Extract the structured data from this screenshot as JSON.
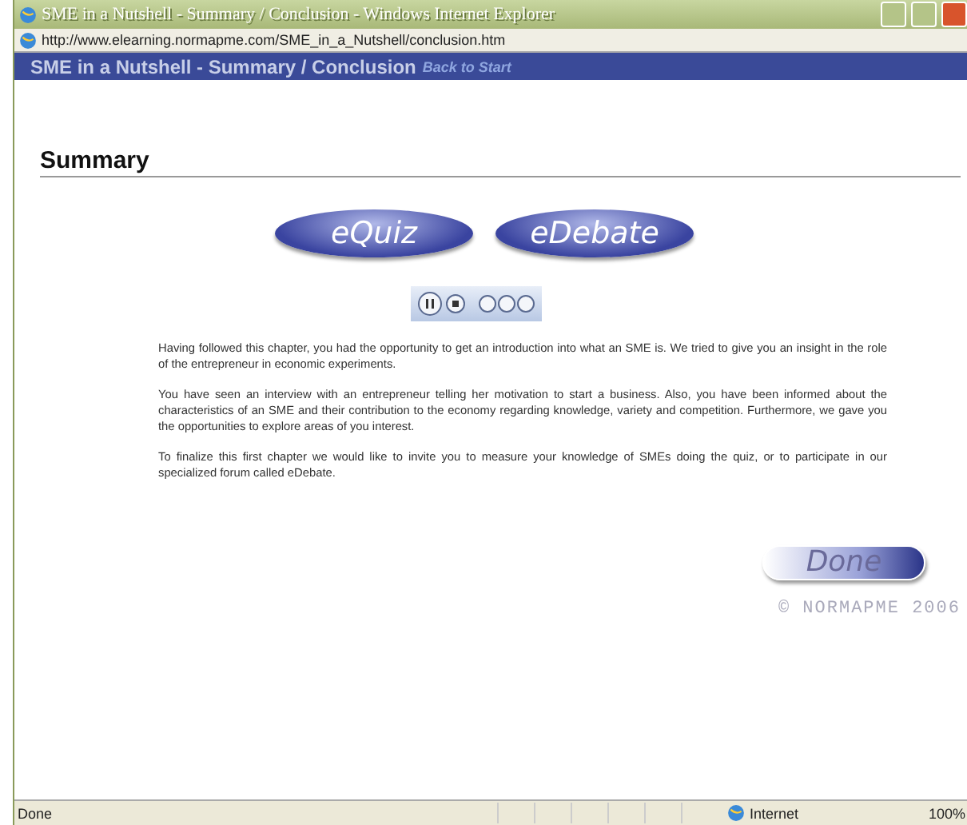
{
  "window": {
    "title": "SME in a Nutshell - Summary / Conclusion - Windows Internet Explorer",
    "address": "http://www.elearning.normapme.com/SME_in_a_Nutshell/conclusion.htm"
  },
  "header": {
    "title": "SME in a Nutshell - Summary / Conclusion",
    "link": "Back to Start"
  },
  "heading": "Summary",
  "nav_buttons": [
    "eQuiz",
    "eDebate"
  ],
  "paragraphs": [
    "Having followed this chapter, you had the opportunity to get an introduction into what an SME is. We tried to give you an insight in the role of the entrepreneur in economic experiments.",
    "You have seen an interview with an entrepreneur telling her motivation to start a business. Also, you have been informed about the characteristics of an SME and their contribution to the economy regarding knowledge, variety and competition. Furthermore, we gave you the opportunities to explore areas of you interest.",
    "To finalize this first chapter we would like to invite you to measure your knowledge of SMEs doing the quiz, or to participate in our specialized forum called eDebate."
  ],
  "done_button": "Done",
  "copyright": "© NORMAPME 2006",
  "status_bar": {
    "text": "Done",
    "zone": "Internet",
    "zoom": "100%"
  }
}
